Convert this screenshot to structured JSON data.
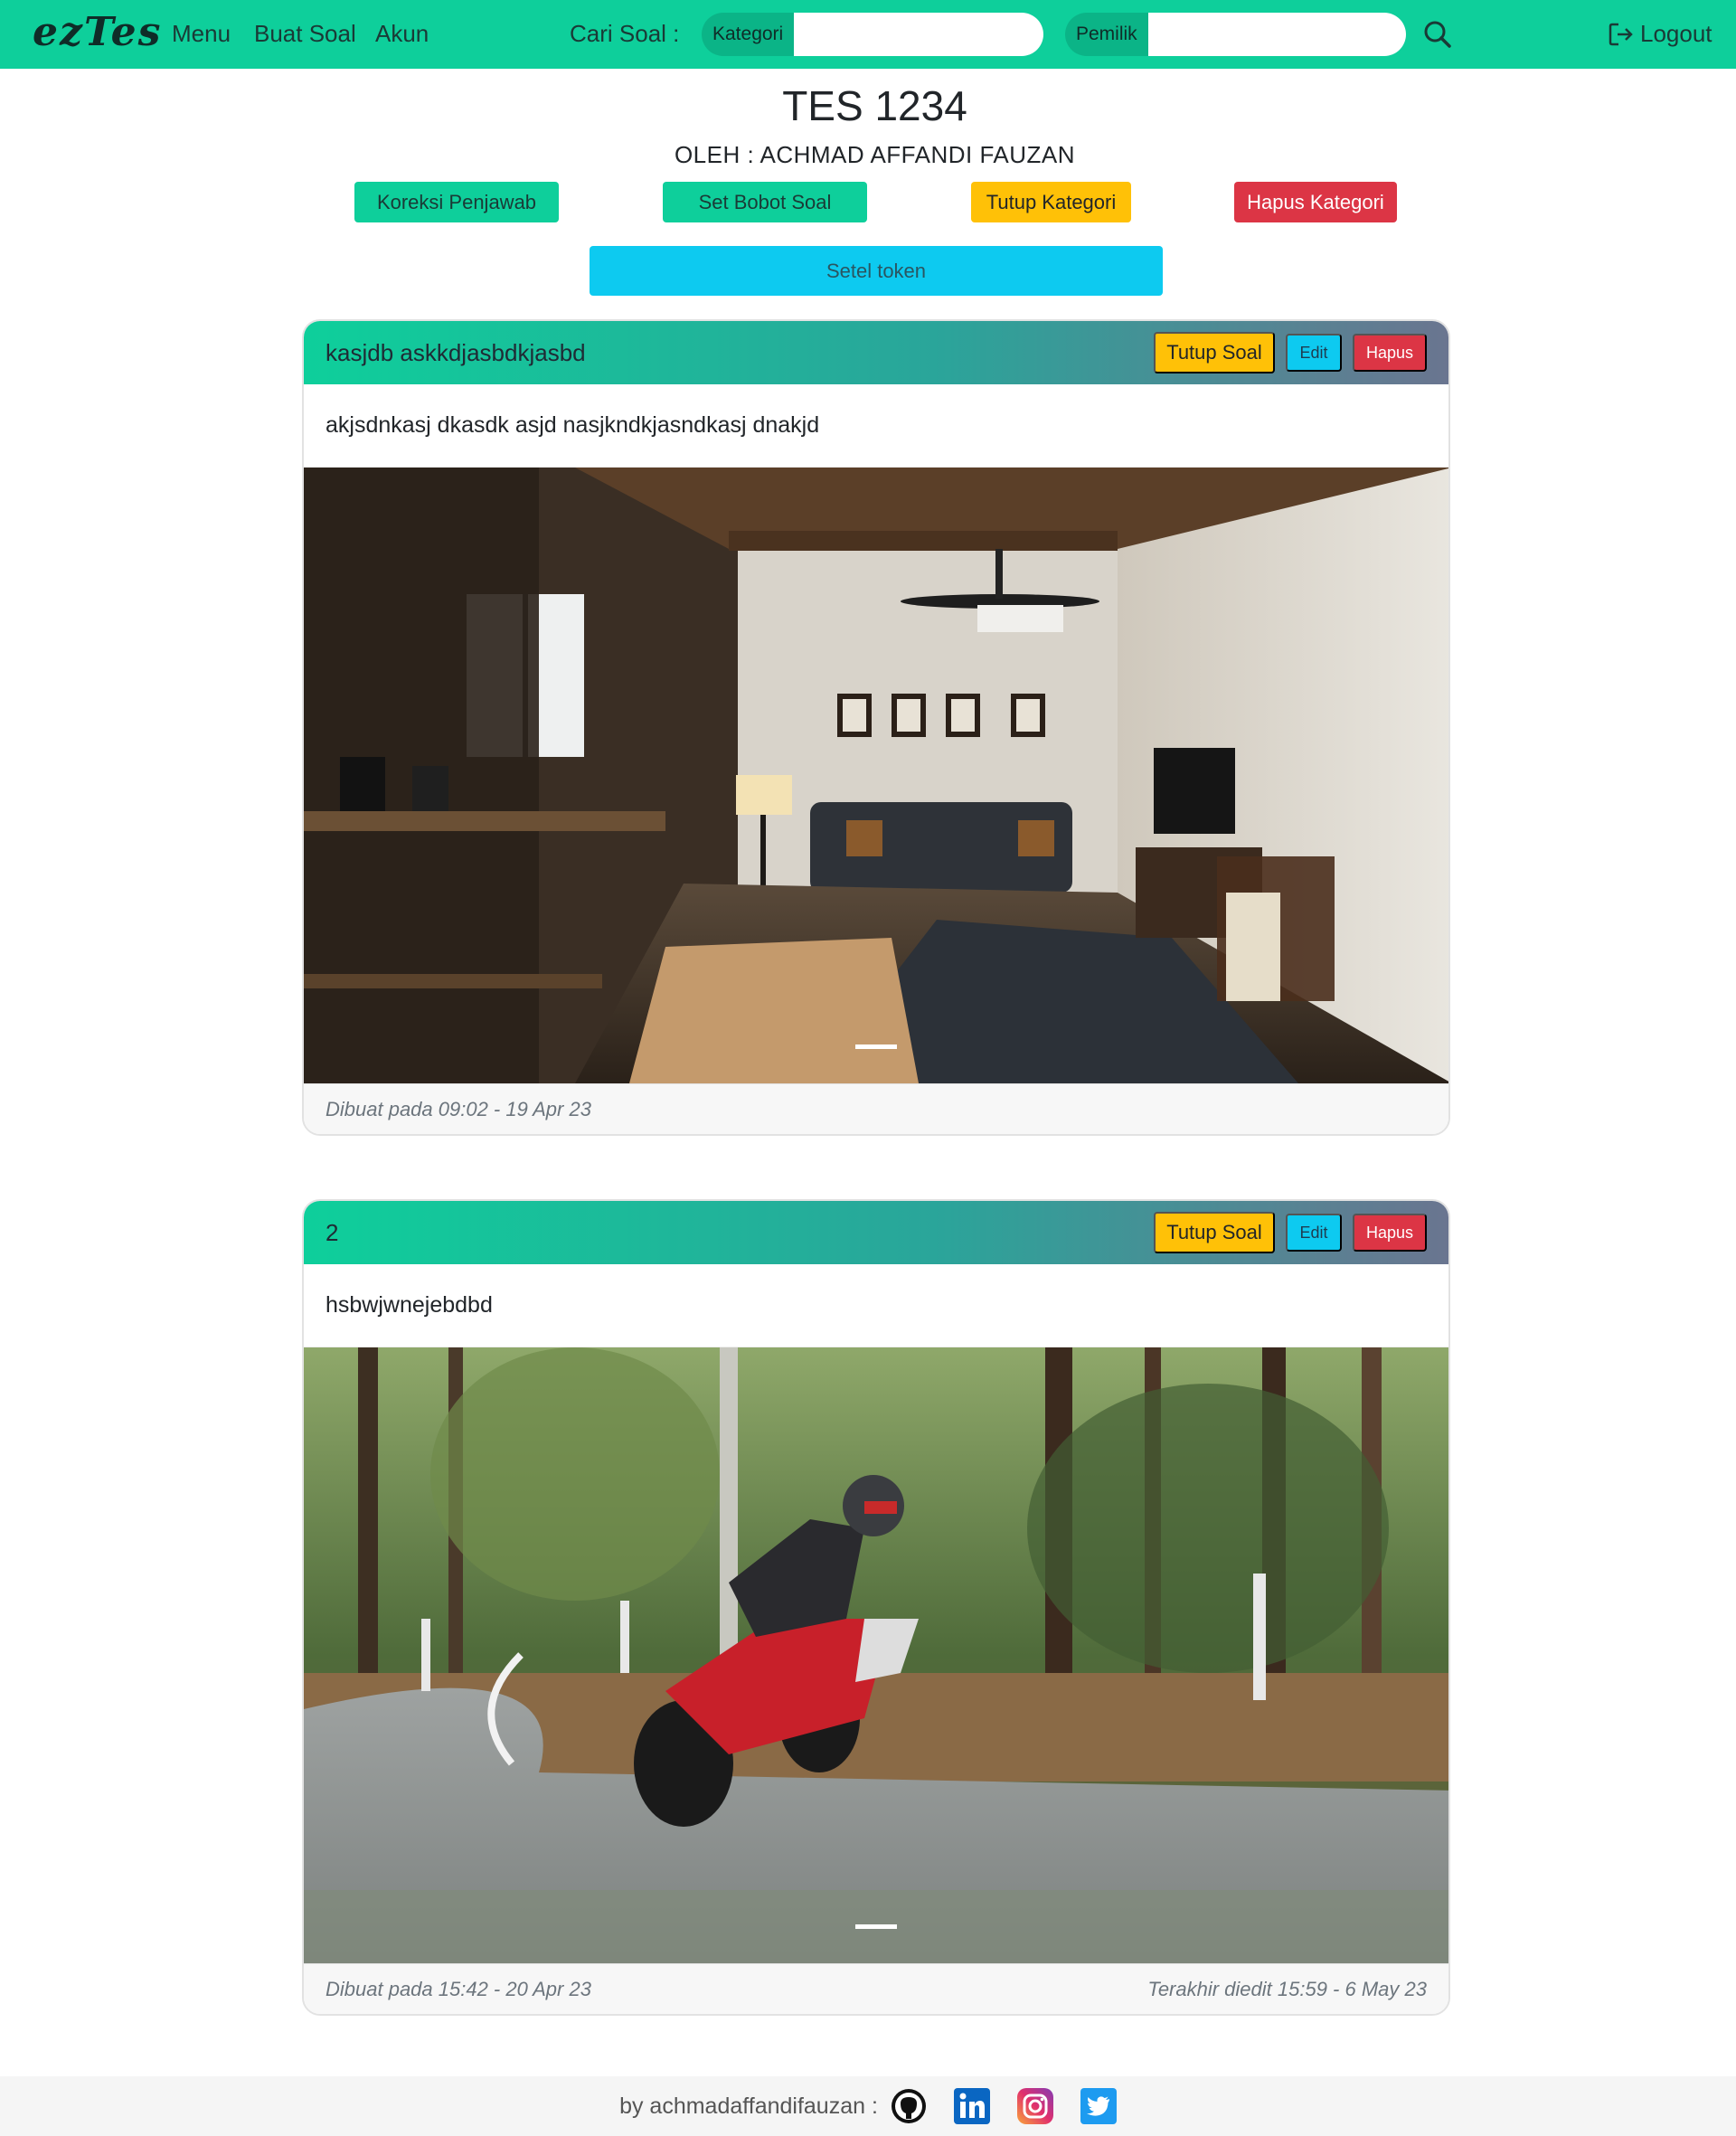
{
  "nav": {
    "brand": "ezTes",
    "links": [
      "Menu",
      "Buat Soal",
      "Akun"
    ],
    "search_label": "Cari Soal :",
    "kategori_prefix": "Kategori",
    "kategori_value": "",
    "pemilik_prefix": "Pemilik",
    "pemilik_value": "",
    "logout": "Logout"
  },
  "header": {
    "title": "TES 1234",
    "owner": "OLEH : ACHMAD AFFANDI FAUZAN"
  },
  "actions": {
    "koreksi": "Koreksi Penjawab",
    "bobot": "Set Bobot Soal",
    "tutup_kategori": "Tutup Kategori",
    "hapus_kategori": "Hapus Kategori",
    "token": "Setel token"
  },
  "questions": [
    {
      "title": "kasjdb askkdjasbdkjasbd",
      "body": "akjsdnkasj dkasdk asjd nasjkndkjasndkasj dnakjd",
      "tutup": "Tutup Soal",
      "edit": "Edit",
      "hapus": "Hapus",
      "created": "Dibuat pada 09:02 - 19 Apr 23",
      "edited": ""
    },
    {
      "title": "2",
      "body": "hsbwjwnejebdbd",
      "tutup": "Tutup Soal",
      "edit": "Edit",
      "hapus": "Hapus",
      "created": "Dibuat pada 15:42 - 20 Apr 23",
      "edited": "Terakhir diedit 15:59 - 6 May 23"
    }
  ],
  "footer": {
    "text": "by achmadaffandifauzan :",
    "icons": [
      "github-icon",
      "linkedin-icon",
      "instagram-icon",
      "twitter-icon"
    ]
  },
  "colors": {
    "primary": "#0ecf9b",
    "warning": "#ffc107",
    "danger": "#dc3545",
    "info": "#0dcaf0"
  }
}
